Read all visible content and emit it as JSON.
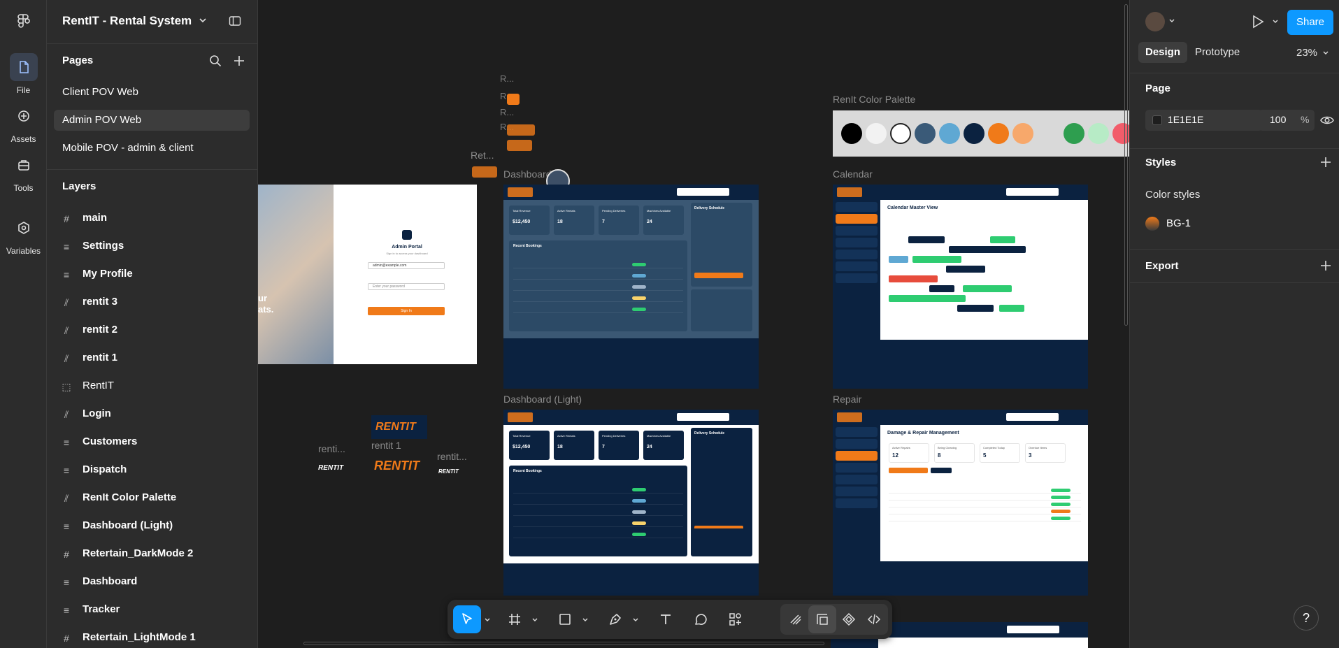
{
  "rail": {
    "items": [
      {
        "label": "File",
        "icon": "file-icon"
      },
      {
        "label": "Assets",
        "icon": "assets-icon"
      },
      {
        "label": "Tools",
        "icon": "tools-icon"
      },
      {
        "label": "Variables",
        "icon": "variables-icon"
      }
    ]
  },
  "file": {
    "title": "RentIT - Rental System"
  },
  "pages": {
    "title": "Pages",
    "items": [
      {
        "label": "Client POV Web"
      },
      {
        "label": "Admin POV Web"
      },
      {
        "label": "Mobile POV - admin & client"
      }
    ]
  },
  "layers": {
    "title": "Layers",
    "items": [
      {
        "label": "main",
        "icon": "frame-icon"
      },
      {
        "label": "Settings",
        "icon": "auto-layout-icon"
      },
      {
        "label": "My Profile",
        "icon": "auto-layout-icon"
      },
      {
        "label": "rentit 3",
        "icon": "horizontal-layout-icon"
      },
      {
        "label": "rentit 2",
        "icon": "horizontal-layout-icon"
      },
      {
        "label": "rentit 1",
        "icon": "horizontal-layout-icon"
      },
      {
        "label": "RentIT",
        "icon": "section-icon"
      },
      {
        "label": "Login",
        "icon": "horizontal-layout-icon"
      },
      {
        "label": "Customers",
        "icon": "auto-layout-icon"
      },
      {
        "label": "Dispatch",
        "icon": "auto-layout-icon"
      },
      {
        "label": "RenIt Color Palette",
        "icon": "horizontal-layout-icon"
      },
      {
        "label": "Dashboard (Light)",
        "icon": "auto-layout-icon"
      },
      {
        "label": "Retertain_DarkMode 2",
        "icon": "frame-icon"
      },
      {
        "label": "Dashboard",
        "icon": "auto-layout-icon"
      },
      {
        "label": "Tracker",
        "icon": "auto-layout-icon"
      },
      {
        "label": "Retertain_LightMode 1",
        "icon": "frame-icon"
      }
    ]
  },
  "canvas": {
    "labels": {
      "palette": "RenIt Color Palette",
      "calendar": "Calendar",
      "dashboard": "Dashboard",
      "dashboard_light": "Dashboard (Light)",
      "repair": "Repair",
      "rentit1": "rentit 1",
      "rentit_a": "renti...",
      "rentit_b": "rentit...",
      "ret": "Ret...",
      "r1": "R...",
      "r2": "R...",
      "r3": "R...",
      "r4": "R..."
    },
    "palette_colors": [
      "#000000",
      "#f2f2f2",
      "#ffffff",
      "#3a5a78",
      "#5fa8d3",
      "#0b2240",
      "#f07a19",
      "#f7a86b",
      "#2e9e4f",
      "#b7ebc6",
      "#f25c6a"
    ],
    "login": {
      "title": "Admin Portal",
      "subtitle": "Sign in to access your dashboard",
      "email": "admin@example.com",
      "password_placeholder": "Enter your password",
      "button": "Sign In",
      "hero_a": "ur",
      "hero_b": "ats."
    },
    "calendar_title": "Calendar Master View",
    "repair_title": "Damage & Repair Management",
    "dash_title": "Recent Bookings",
    "dash_side": "Delivery Schedule",
    "stats": [
      {
        "label": "Total Revenue",
        "value": "$12,450"
      },
      {
        "label": "Active Rentals",
        "value": "18"
      },
      {
        "label": "Pending Deliveries",
        "value": "7"
      },
      {
        "label": "Machines Available",
        "value": "24"
      }
    ],
    "repair_stats": [
      {
        "label": "Active Repairs",
        "value": "12"
      },
      {
        "label": "Being Cleaning",
        "value": "8"
      },
      {
        "label": "Completed Today",
        "value": "5"
      },
      {
        "label": "Overdue Items",
        "value": "3"
      }
    ],
    "logo_text": "RENTIT"
  },
  "right": {
    "tabs": [
      {
        "label": "Design"
      },
      {
        "label": "Prototype"
      }
    ],
    "zoom": "23%",
    "share": "Share",
    "page_title": "Page",
    "page_fill_hex": "1E1E1E",
    "page_opacity": "100",
    "pct": "%",
    "styles_title": "Styles",
    "color_styles": "Color styles",
    "style_name": "BG-1",
    "export_title": "Export"
  },
  "help": "?"
}
